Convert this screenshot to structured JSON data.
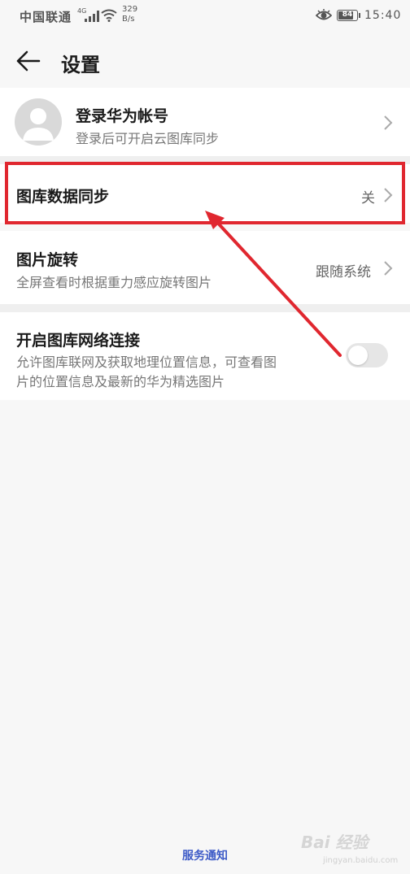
{
  "status_bar": {
    "carrier": "中国联通",
    "network_type": "4G",
    "net_speed_value": "329",
    "net_speed_unit": "B/s",
    "battery_level": "84",
    "battery_fraction": 0.84,
    "time": "15:40"
  },
  "header": {
    "title": "设置"
  },
  "account_row": {
    "title": "登录华为帐号",
    "subtitle": "登录后可开启云图库同步"
  },
  "sync_row": {
    "title": "图库数据同步",
    "value": "关"
  },
  "rotation_row": {
    "title": "图片旋转",
    "subtitle": "全屏查看时根据重力感应旋转图片",
    "value": "跟随系统"
  },
  "network_row": {
    "title": "开启图库网络连接",
    "subtitle_line1": "允许图库联网及获取地理位置信息，可查看图",
    "subtitle_line2": "片的位置信息及最新的华为精选图片",
    "toggle_on": false
  },
  "footer": {
    "service_link": "服务通知"
  },
  "watermark": {
    "text": "Bai 经验",
    "url": "jingyan.baidu.com"
  },
  "colors": {
    "highlight": "#e0272f",
    "link": "#3d5bc7",
    "background": "#f7f7f7"
  },
  "icons": [
    "back-arrow-icon",
    "chevron-right-icon",
    "avatar-placeholder-icon",
    "wifi-icon",
    "eye-icon",
    "signal-icon",
    "battery-icon"
  ]
}
